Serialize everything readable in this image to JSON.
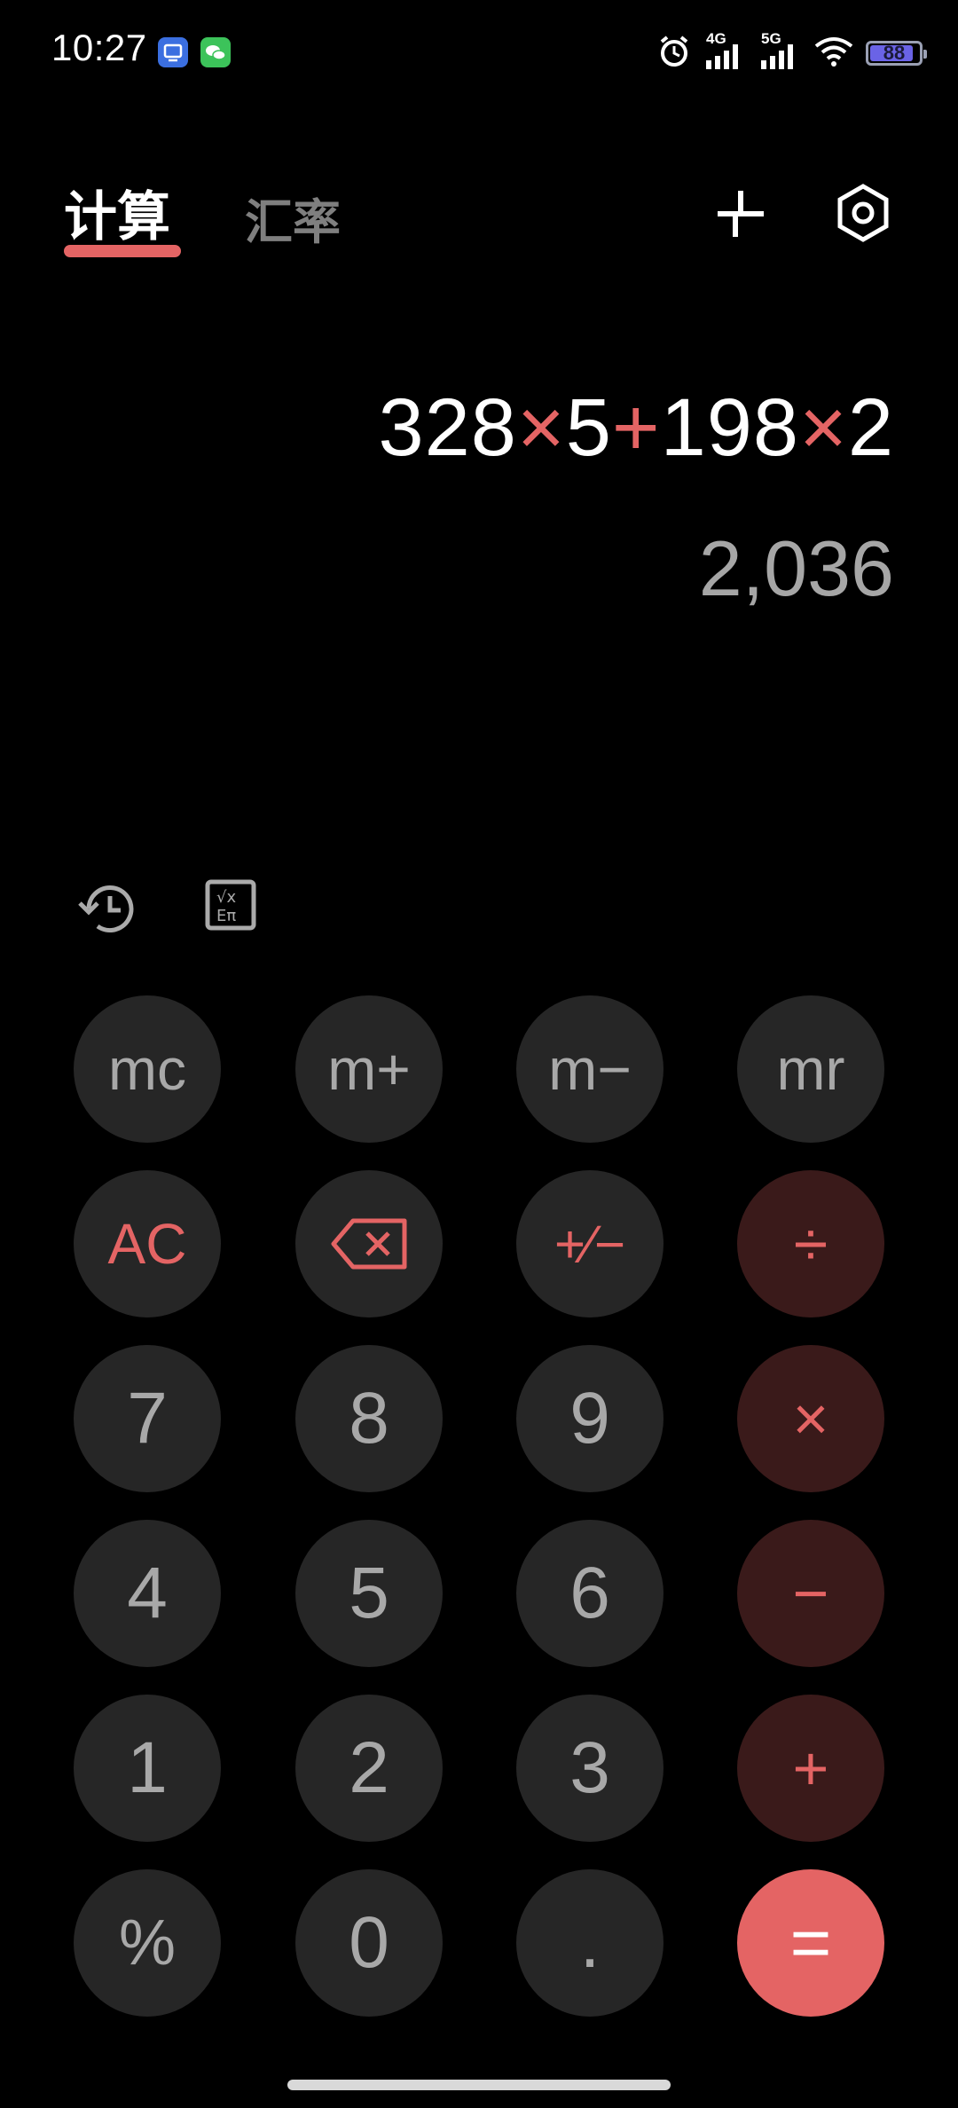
{
  "status_bar": {
    "time": "10:27",
    "network_1": "4G",
    "network_2": "5G",
    "battery": "88"
  },
  "header": {
    "tabs": [
      {
        "label": "计算",
        "active": true
      },
      {
        "label": "汇率",
        "active": false
      }
    ],
    "accent_color": "#e46464"
  },
  "display": {
    "expression_parts": [
      "328",
      "×",
      "5",
      "+",
      "198",
      "×",
      "2"
    ],
    "result": "2,036"
  },
  "keypad": {
    "row1": [
      "mc",
      "m+",
      "m−",
      "mr"
    ],
    "row2": [
      "AC",
      "backspace",
      "+∕−",
      "÷"
    ],
    "row3": [
      "7",
      "8",
      "9",
      "×"
    ],
    "row4": [
      "4",
      "5",
      "6",
      "−"
    ],
    "row5": [
      "1",
      "2",
      "3",
      "+"
    ],
    "row6": [
      "%",
      "0",
      ".",
      "="
    ]
  },
  "labels": {
    "mc": "mc",
    "mplus": "m+",
    "mminus": "m−",
    "mr": "mr",
    "ac": "AC",
    "sign": "+∕−",
    "divide": "÷",
    "seven": "7",
    "eight": "8",
    "nine": "9",
    "multiply": "×",
    "four": "4",
    "five": "5",
    "six": "6",
    "minus": "−",
    "one": "1",
    "two": "2",
    "three": "3",
    "plus": "+",
    "percent": "%",
    "zero": "0",
    "dot": ".",
    "equals": "="
  }
}
